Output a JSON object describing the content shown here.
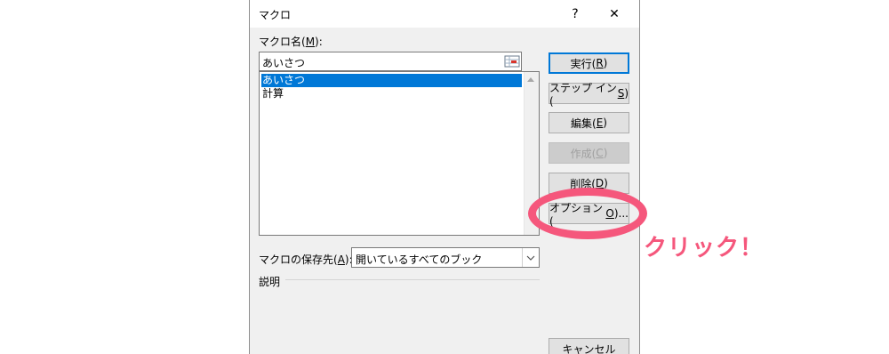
{
  "window": {
    "title": "マクロ",
    "help_glyph": "?",
    "close_glyph": "✕"
  },
  "macro_name": {
    "label_prefix": "マクロ名(",
    "label_accel": "M",
    "label_suffix": "):",
    "value": "あいさつ"
  },
  "macro_list": {
    "items": [
      "あいさつ",
      "計算"
    ],
    "selected_index": 0
  },
  "buttons": [
    {
      "prefix": "実行(",
      "accel": "R",
      "suffix": ")",
      "enabled": true,
      "default": true
    },
    {
      "prefix": "ステップ イン(",
      "accel": "S",
      "suffix": ")",
      "enabled": true
    },
    {
      "prefix": "編集(",
      "accel": "E",
      "suffix": ")",
      "enabled": true
    },
    {
      "prefix": "作成(",
      "accel": "C",
      "suffix": ")",
      "enabled": false
    },
    {
      "prefix": "削除(",
      "accel": "D",
      "suffix": ")",
      "enabled": true
    },
    {
      "prefix": "オプション(",
      "accel": "O",
      "suffix": ")...",
      "enabled": true
    },
    {
      "label": "キャンセル",
      "enabled": true
    }
  ],
  "store_in": {
    "label_prefix": "マクロの保存先(",
    "label_accel": "A",
    "label_suffix": "):",
    "value": "開いているすべてのブック"
  },
  "description": {
    "label": "説明"
  },
  "annotation": {
    "text": "クリック！",
    "color": "#f5577c"
  },
  "colors": {
    "selection": "#0078d7",
    "dialog_bg": "#f0f0f0",
    "accent": "#f5577c"
  }
}
